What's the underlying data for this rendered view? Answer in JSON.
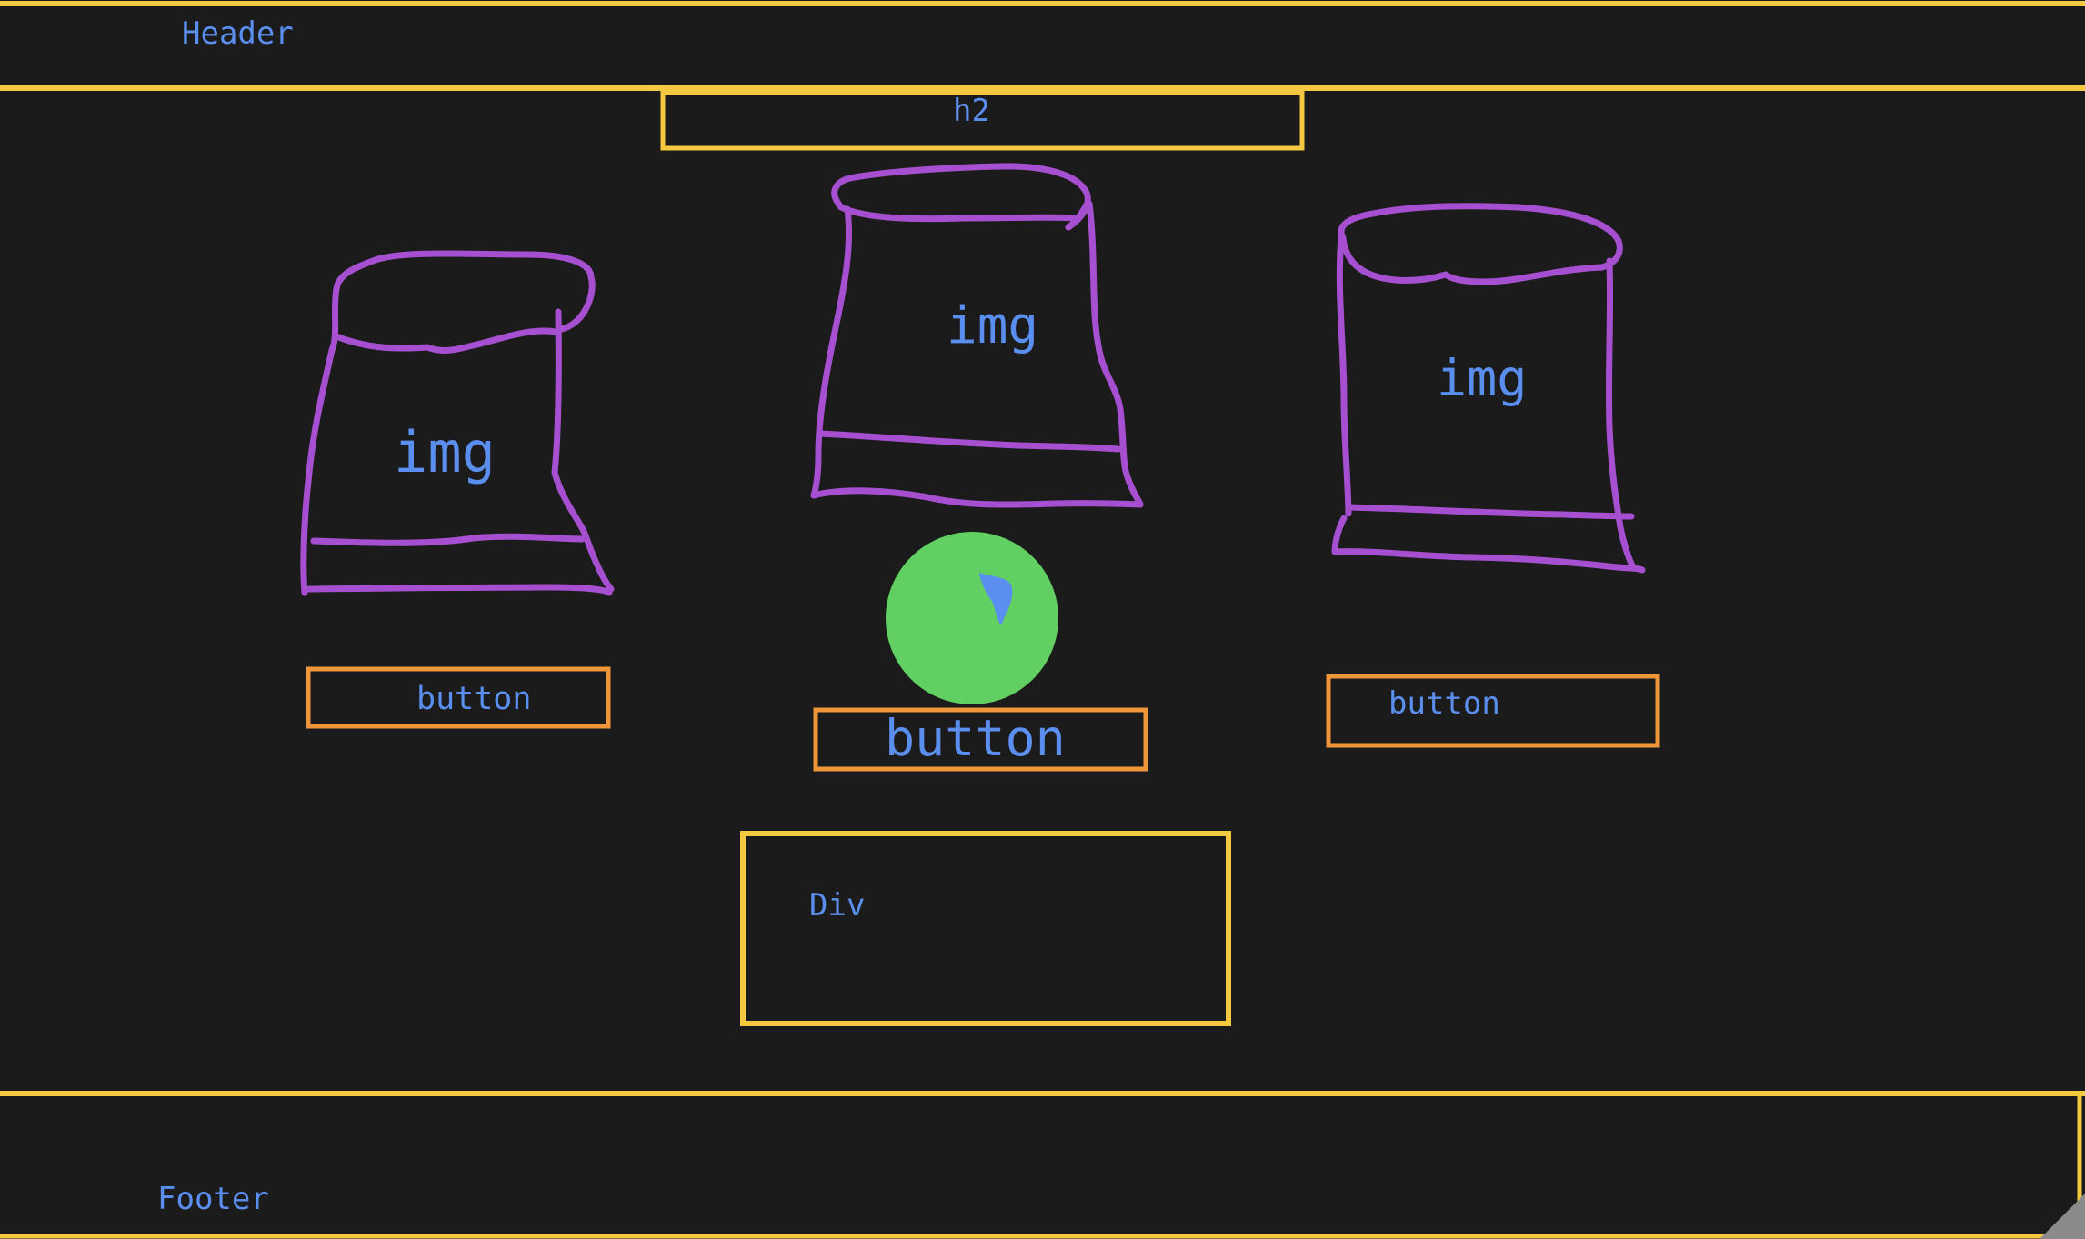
{
  "header": {
    "label": "Header"
  },
  "heading": {
    "label": "h2"
  },
  "cards": [
    {
      "image_label": "img",
      "button_label": "button"
    },
    {
      "image_label": "img",
      "button_label": "button"
    },
    {
      "image_label": "img",
      "button_label": "button"
    }
  ],
  "container": {
    "label": "Div"
  },
  "footer": {
    "label": "Footer"
  },
  "colors": {
    "background": "#1b1b1b",
    "container_outline": "#f5c842",
    "button_outline": "#f0963a",
    "image_outline": "#a64fd0",
    "label_text": "#5a8ff0",
    "cursor_highlight": "#62cf62",
    "cursor": "#5a8ff0"
  }
}
